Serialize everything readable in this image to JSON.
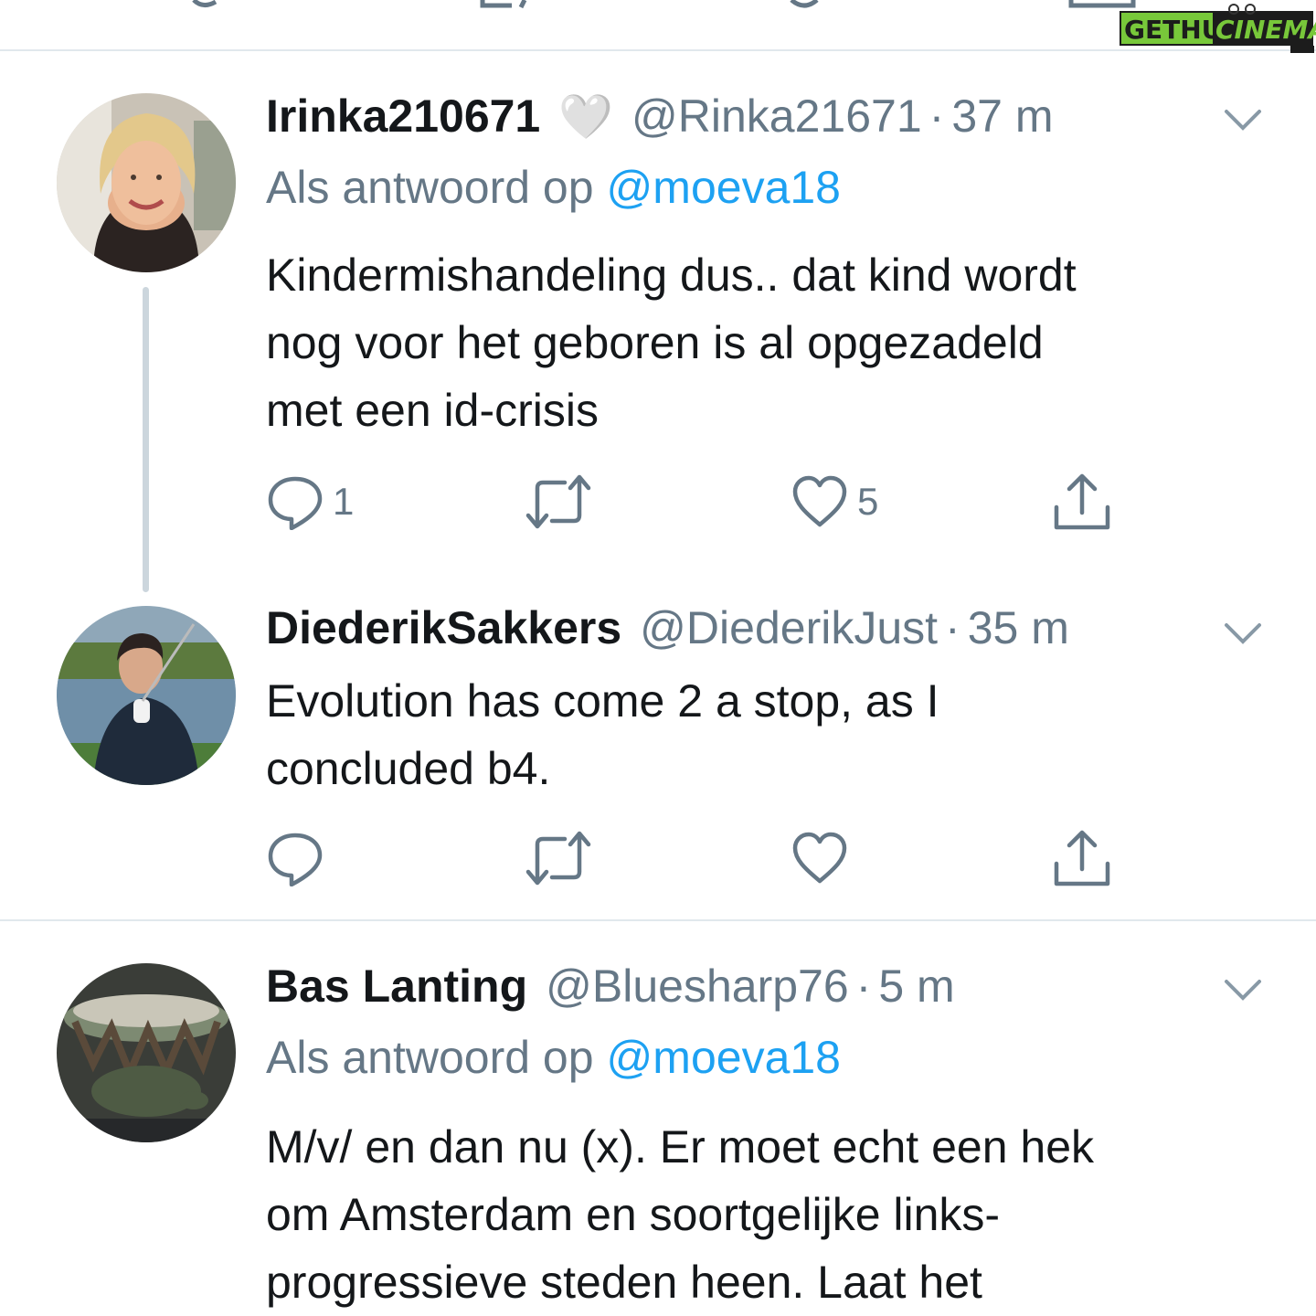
{
  "watermark": {
    "text": "GETHUCINEMA"
  },
  "colors": {
    "link": "#1da1f2",
    "muted": "#657786",
    "text": "#14171a",
    "divider": "#e1e8ed"
  },
  "tweets": [
    {
      "display_name": "Irinka210671",
      "name_emoji": "🤍",
      "handle": "@Rinka21671",
      "separator": "·",
      "time": "37 m",
      "reply_prefix": "Als antwoord op",
      "reply_handle": "@moeva18",
      "lines": [
        "Kindermishandeling dus.. dat kind wordt",
        "nog voor het geboren is al opgezadeld",
        "met een id-crisis"
      ],
      "replies": "1",
      "retweets": "",
      "likes": "5"
    },
    {
      "display_name": "DiederikSakkers",
      "handle": "@DiederikJust",
      "separator": "·",
      "time": "35 m",
      "lines": [
        "Evolution has come 2 a stop, as I",
        "concluded b4."
      ],
      "replies": "",
      "retweets": "",
      "likes": ""
    },
    {
      "display_name": "Bas Lanting",
      "handle": "@Bluesharp76",
      "separator": "·",
      "time": "5 m",
      "reply_prefix": "Als antwoord op",
      "reply_handle": "@moeva18",
      "lines": [
        "M/v/ en dan nu (x). Er moet echt een hek",
        "om Amsterdam en soortgelijke links-",
        "progressieve steden heen. Laat het"
      ]
    }
  ]
}
